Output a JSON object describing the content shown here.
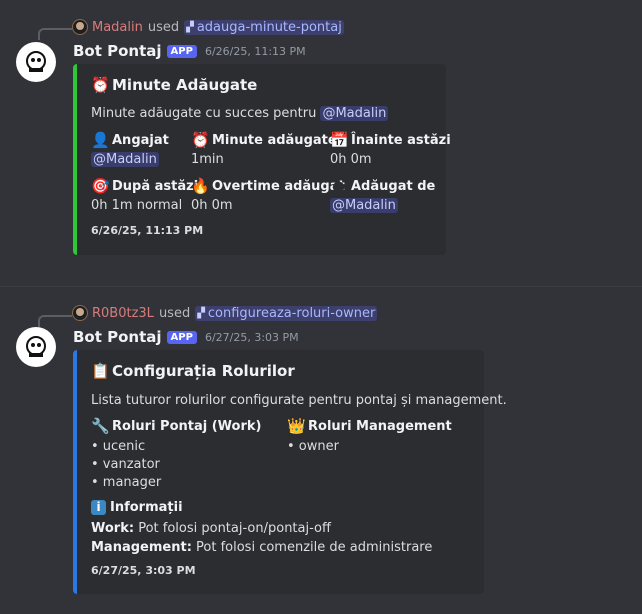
{
  "messages": [
    {
      "reply": {
        "user": "Madalin",
        "used": "used",
        "command": "adauga-minute-pontaj"
      },
      "author": "Bot Pontaj",
      "badge": "APP",
      "timestamp": "6/26/25, 11:13 PM",
      "embed": {
        "accent": "#2ec735",
        "title": "Minute Adăugate",
        "title_icon": "alarm-clock-icon",
        "description_prefix": "Minute adăugate cu succes pentru",
        "description_mention": "@Madalin",
        "fields": [
          {
            "icon": "user-icon",
            "name": "Angajat",
            "value": "@Madalin",
            "mention": true
          },
          {
            "icon": "alarm-clock-icon",
            "name": "Minute adăugate",
            "value": "1min",
            "mention": false
          },
          {
            "icon": "calendar-icon",
            "name": "Înainte astăzi",
            "value": "0h 0m",
            "mention": false
          },
          {
            "icon": "target-icon",
            "name": "După astăzi",
            "value": "0h 1m normal",
            "mention": false
          },
          {
            "icon": "fire-icon",
            "name": "Overtime adăugat",
            "value": "0h 0m",
            "mention": false
          },
          {
            "icon": "person-silhouette-icon",
            "name": "Adăugat de",
            "value": "@Madalin",
            "mention": true
          }
        ],
        "footer": "6/26/25, 11:13 PM"
      }
    },
    {
      "reply": {
        "user": "R0B0tz3L",
        "used": "used",
        "command": "configureaza-roluri-owner"
      },
      "author": "Bot Pontaj",
      "badge": "APP",
      "timestamp": "6/27/25, 3:03 PM",
      "embed": {
        "accent": "#2b78e4",
        "title": "Configurația Rolurilor",
        "title_icon": "clipboard-icon",
        "description": "Lista tuturor rolurilor configurate pentru pontaj și management.",
        "work_roles_title": "Roluri Pontaj (Work)",
        "work_roles": [
          "• ucenic",
          "• vanzator",
          "• manager"
        ],
        "mgmt_roles_title": "Roluri Management",
        "mgmt_roles": [
          "• owner"
        ],
        "info_title": "Informații",
        "info_lines": [
          {
            "label": "Work:",
            "text": " Pot folosi pontaj-on/pontaj-off"
          },
          {
            "label": "Management:",
            "text": " Pot folosi comenzile de administrare"
          }
        ],
        "footer": "6/27/25, 3:03 PM"
      }
    }
  ]
}
